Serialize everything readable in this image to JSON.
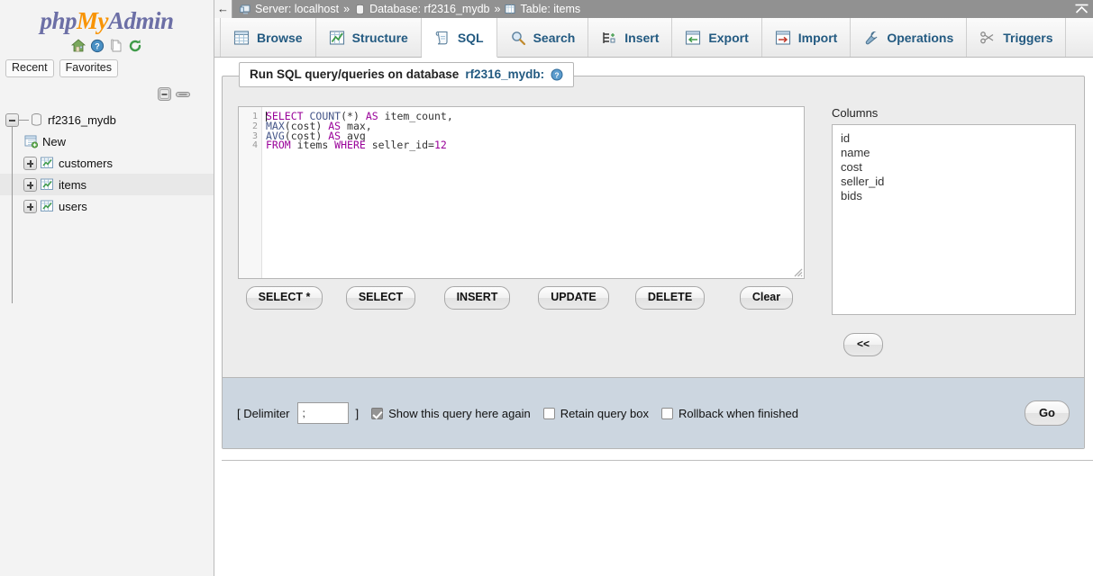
{
  "sidebar": {
    "logo": {
      "part1": "php",
      "part2": "My",
      "part3": "Admin"
    },
    "logo_icons": [
      {
        "name": "home-icon",
        "label": "Home"
      },
      {
        "name": "help-icon",
        "label": "Documentation"
      },
      {
        "name": "doc-icon",
        "label": "Docs"
      },
      {
        "name": "reload-icon",
        "label": "Reload"
      }
    ],
    "chips": [
      {
        "label": "Recent"
      },
      {
        "label": "Favorites"
      }
    ],
    "tree_tools": [
      {
        "name": "collapse-tree-icon"
      },
      {
        "name": "link-tree-icon"
      }
    ],
    "tree": {
      "database": "rf2316_mydb",
      "items": [
        {
          "label": "New",
          "kind": "new",
          "expandable": false,
          "selected": false
        },
        {
          "label": "customers",
          "kind": "table",
          "expandable": true,
          "selected": false
        },
        {
          "label": "items",
          "kind": "table",
          "expandable": true,
          "selected": true
        },
        {
          "label": "users",
          "kind": "table",
          "expandable": true,
          "selected": false
        }
      ]
    }
  },
  "breadcrumb": {
    "back_glyph": "←",
    "server_label": "Server: localhost",
    "sep1": "»",
    "database_label": "Database: rf2316_mydb",
    "sep2": "»",
    "table_label": "Table: items",
    "collapse_icon": "collapse-all-icon"
  },
  "tabs": [
    {
      "label": "Browse",
      "icon": "browse-icon",
      "active": false
    },
    {
      "label": "Structure",
      "icon": "structure-icon",
      "active": false
    },
    {
      "label": "SQL",
      "icon": "sql-icon",
      "active": true
    },
    {
      "label": "Search",
      "icon": "search-icon",
      "active": false
    },
    {
      "label": "Insert",
      "icon": "insert-icon",
      "active": false
    },
    {
      "label": "Export",
      "icon": "export-icon",
      "active": false
    },
    {
      "label": "Import",
      "icon": "import-icon",
      "active": false
    },
    {
      "label": "Operations",
      "icon": "operations-icon",
      "active": false
    },
    {
      "label": "Triggers",
      "icon": "triggers-icon",
      "active": false
    }
  ],
  "card": {
    "legend_text": "Run SQL query/queries on database",
    "legend_db": "rf2316_mydb:",
    "help_icon": "help-circle-icon"
  },
  "editor": {
    "line_numbers": [
      "1",
      "2",
      "3",
      "4"
    ],
    "lines": [
      {
        "tokens": [
          {
            "t": "SELECT",
            "c": "kw"
          },
          {
            "t": " ",
            "c": "op"
          },
          {
            "t": "COUNT",
            "c": "fn"
          },
          {
            "t": "(*) ",
            "c": "op"
          },
          {
            "t": "AS",
            "c": "kw"
          },
          {
            "t": " item_count,",
            "c": "id"
          }
        ]
      },
      {
        "tokens": [
          {
            "t": "MAX",
            "c": "fn"
          },
          {
            "t": "(cost) ",
            "c": "op"
          },
          {
            "t": "AS",
            "c": "kw"
          },
          {
            "t": " max,",
            "c": "id"
          }
        ]
      },
      {
        "tokens": [
          {
            "t": "AVG",
            "c": "fn"
          },
          {
            "t": "(cost) ",
            "c": "op"
          },
          {
            "t": "AS",
            "c": "kw"
          },
          {
            "t": " avg",
            "c": "id"
          }
        ]
      },
      {
        "tokens": [
          {
            "t": "FROM",
            "c": "kw"
          },
          {
            "t": " items ",
            "c": "id"
          },
          {
            "t": "WHERE",
            "c": "kw"
          },
          {
            "t": " seller_id=",
            "c": "id"
          },
          {
            "t": "12",
            "c": "num"
          }
        ]
      }
    ],
    "plain_text": "SELECT COUNT(*) AS item_count,\nMAX(cost) AS max,\nAVG(cost) AS avg\nFROM items WHERE seller_id=12"
  },
  "action_buttons": [
    {
      "label": "SELECT *"
    },
    {
      "label": "SELECT"
    },
    {
      "label": "INSERT"
    },
    {
      "label": "UPDATE"
    },
    {
      "label": "DELETE"
    },
    {
      "label": "Clear"
    }
  ],
  "columns_panel": {
    "caption": "Columns",
    "columns": [
      "id",
      "name",
      "cost",
      "seller_id",
      "bids"
    ],
    "back_button": "<<"
  },
  "query_options": {
    "delimiter_open": "[ Delimiter",
    "delimiter_value": ";",
    "delimiter_close": "]",
    "checkboxes": [
      {
        "label": "Show this query here again",
        "checked": true
      },
      {
        "label": "Retain query box",
        "checked": false
      },
      {
        "label": "Rollback when finished",
        "checked": false
      }
    ],
    "go_label": "Go"
  },
  "footer": {
    "console_icon": "console-window-icon"
  },
  "colors": {
    "accent_blue": "#235a81",
    "logo_purple": "#6c6fa6",
    "logo_orange": "#f89406",
    "card_bg": "#ececec",
    "footbar_bg": "#ccd6e0",
    "crumb_bg": "#919191",
    "sql_keyword": "#990099",
    "sql_function": "#445588"
  }
}
